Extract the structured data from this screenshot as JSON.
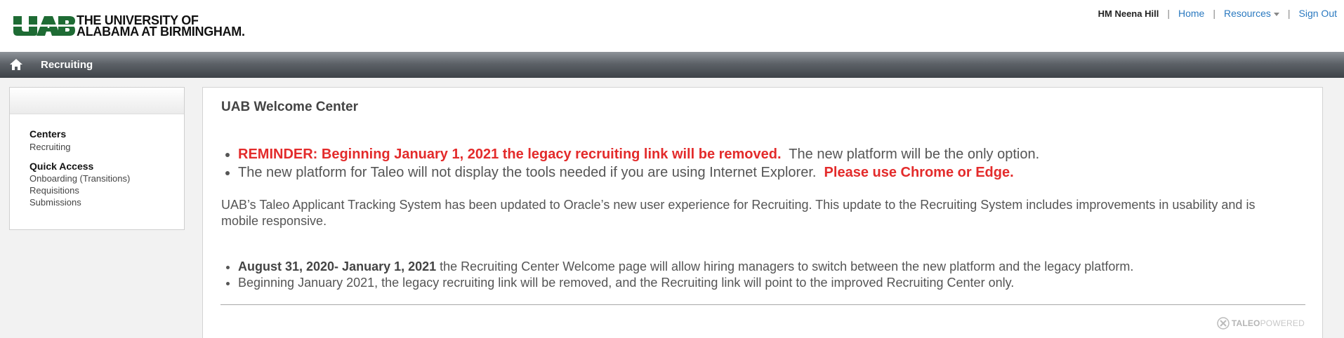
{
  "header": {
    "logo_line1": "THE UNIVERSITY OF",
    "logo_line2": "ALABAMA AT BIRMINGHAM.",
    "brand_color": "#1e6b34",
    "user": "HM Neena Hill",
    "home": "Home",
    "resources": "Resources",
    "signout": "Sign Out",
    "separator": "|"
  },
  "navbar": {
    "title": "Recruiting",
    "home_icon": "home-icon"
  },
  "sidebar": {
    "centers_title": "Centers",
    "centers_items": [
      "Recruiting"
    ],
    "quick_title": "Quick Access",
    "quick_items": [
      "Onboarding (Transitions)",
      "Requisitions",
      "Submissions"
    ]
  },
  "main": {
    "title": "UAB Welcome Center",
    "reminder_red": "REMINDER:  Beginning January 1, 2021 the legacy recruiting link will be removed.",
    "reminder_rest": "  The new platform will be the only option.",
    "ie_text": "The new platform for Taleo will not display the tools needed if you are using Internet Explorer.  ",
    "ie_red": "Please use Chrome or Edge.",
    "paragraph": "UAB’s Taleo Applicant Tracking System has been updated to Oracle’s new user experience for Recruiting. This update to the Recruiting System includes improvements in usability and is mobile responsive.",
    "date_bold": "August 31, 2020- January 1, 2021",
    "date_rest": " the Recruiting Center Welcome page will allow hiring managers to switch between the new platform and the legacy platform.",
    "beginning_text": "Beginning January 2021, the legacy recruiting link will be removed, and the Recruiting link will point to the improved Recruiting Center only.",
    "taleo_bold": "TALEO",
    "taleo_light": "POWERED",
    "alert_color": "#e32b2b"
  }
}
